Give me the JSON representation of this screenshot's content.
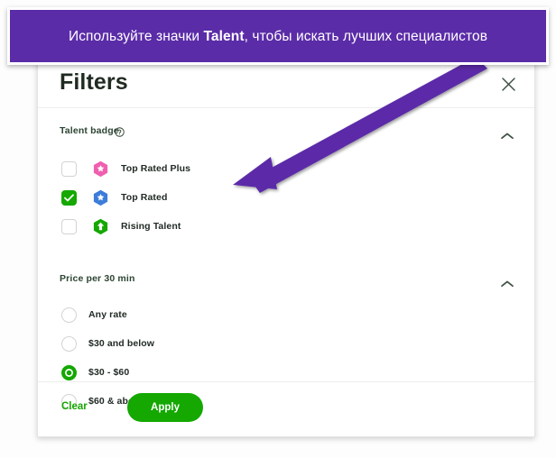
{
  "banner": {
    "text_before": "Используйте значки ",
    "text_bold": "Talent",
    "text_after": ", чтобы искать лучших специалистов",
    "full_text": "Используйте значки Talent, чтобы искать лучших специалистов",
    "background_color": "#5b2ca8",
    "text_color": "#ffffff"
  },
  "annotation": {
    "arrow_color": "#5b2ca8",
    "points_to": "Top Rated badge icon"
  },
  "card": {
    "title": "Filters",
    "close_icon": "close-icon",
    "sections": [
      {
        "title": "Talent badge",
        "help_icon": "help-circle-icon",
        "collapse_icon": "chevron-up-icon",
        "type": "checkbox",
        "options": [
          {
            "label": "Top Rated Plus",
            "checked": false,
            "badge_icon": "top-rated-plus-badge-icon",
            "badge_color": "#ef5fb0"
          },
          {
            "label": "Top Rated",
            "checked": true,
            "badge_icon": "top-rated-badge-icon",
            "badge_color": "#3c7dd9"
          },
          {
            "label": "Rising Talent",
            "checked": false,
            "badge_icon": "rising-talent-badge-icon",
            "badge_color": "#14a800"
          }
        ]
      },
      {
        "title": "Price per 30 min",
        "collapse_icon": "chevron-up-icon",
        "type": "radio",
        "options": [
          {
            "label": "Any rate",
            "selected": false
          },
          {
            "label": "$30 and below",
            "selected": false
          },
          {
            "label": "$30 - $60",
            "selected": true
          },
          {
            "label": "$60 & above",
            "selected": false
          }
        ]
      }
    ],
    "footer": {
      "clear_label": "Clear",
      "apply_label": "Apply",
      "accent_color": "#14a800"
    }
  }
}
